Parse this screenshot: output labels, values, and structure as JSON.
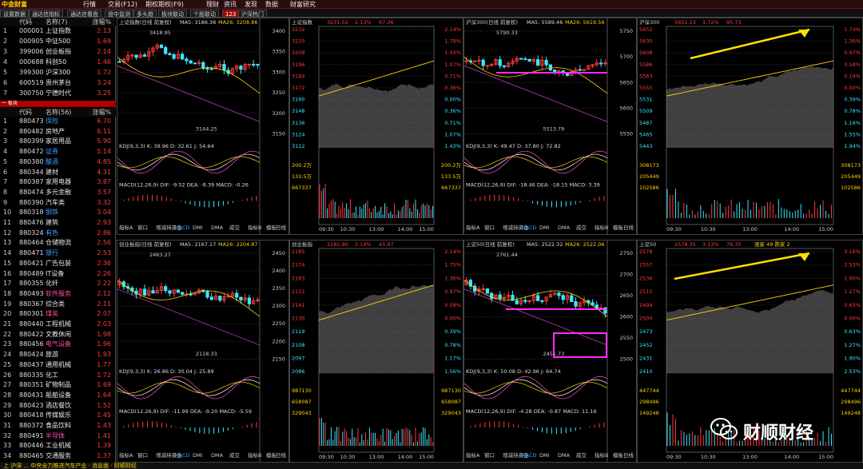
{
  "app": {
    "logo_text": "中金财富",
    "menu": [
      "行情",
      "交易(F12)",
      "期权期权(F9)",
      "理财",
      "资讯",
      "发现",
      "数据",
      "财富研究"
    ]
  },
  "tabs": [
    "设置数据",
    "通达信指标",
    "通达信看盘",
    "盘中监测",
    "多头趋",
    "板块联动",
    "个股联动",
    "123",
    "沪深热门"
  ],
  "left_panel": {
    "header1": {
      "code": "代码",
      "name": "名称(7)",
      "pct": "涨幅%"
    },
    "indices": [
      {
        "idx": "1",
        "code": "000001",
        "name": "上证指数",
        "pct": "2.13"
      },
      {
        "idx": "2",
        "code": "000905",
        "name": "中证500",
        "pct": "1.69"
      },
      {
        "idx": "3",
        "code": "399006",
        "name": "创业板指",
        "pct": "2.14"
      },
      {
        "idx": "4",
        "code": "000688",
        "name": "科创50",
        "pct": "1.46"
      },
      {
        "idx": "5",
        "code": "399300",
        "name": "沪深300",
        "pct": "1.72"
      },
      {
        "idx": "6",
        "code": "600519",
        "name": "贵州茅台",
        "pct": "3.24"
      },
      {
        "idx": "7",
        "code": "300750",
        "name": "宁德时代",
        "pct": "3.25"
      }
    ],
    "divider": "一 板块",
    "header2": {
      "code": "代码",
      "name": "名称(56)",
      "pct": "涨幅%"
    },
    "sectors": [
      {
        "idx": "1",
        "code": "880473",
        "name": "保险",
        "pct": "6.70",
        "color": "blue"
      },
      {
        "idx": "2",
        "code": "880482",
        "name": "房地产",
        "pct": "6.11",
        "color": ""
      },
      {
        "idx": "3",
        "code": "880399",
        "name": "家居用品",
        "pct": "5.90",
        "color": ""
      },
      {
        "idx": "4",
        "code": "880472",
        "name": "证券",
        "pct": "5.14",
        "color": "blue"
      },
      {
        "idx": "5",
        "code": "880380",
        "name": "酿酒",
        "pct": "4.85",
        "color": "blue"
      },
      {
        "idx": "6",
        "code": "880344",
        "name": "建材",
        "pct": "4.31",
        "color": ""
      },
      {
        "idx": "7",
        "code": "880387",
        "name": "家用电器",
        "pct": "3.87",
        "color": ""
      },
      {
        "idx": "8",
        "code": "880474",
        "name": "多元金融",
        "pct": "3.57",
        "color": ""
      },
      {
        "idx": "9",
        "code": "880390",
        "name": "汽车类",
        "pct": "3.32",
        "color": ""
      },
      {
        "idx": "10",
        "code": "880318",
        "name": "钢铁",
        "pct": "3.04",
        "color": "blue"
      },
      {
        "idx": "11",
        "code": "880476",
        "name": "建筑",
        "pct": "2.93",
        "color": ""
      },
      {
        "idx": "12",
        "code": "880324",
        "name": "有色",
        "pct": "2.86",
        "color": "blue"
      },
      {
        "idx": "13",
        "code": "880464",
        "name": "仓储物流",
        "pct": "2.56",
        "color": ""
      },
      {
        "idx": "14",
        "code": "880471",
        "name": "银行",
        "pct": "2.53",
        "color": "blue"
      },
      {
        "idx": "15",
        "code": "880421",
        "name": "广告包装",
        "pct": "2.36",
        "color": ""
      },
      {
        "idx": "16",
        "code": "880489",
        "name": "IT设备",
        "pct": "2.26",
        "color": ""
      },
      {
        "idx": "17",
        "code": "880355",
        "name": "化纤",
        "pct": "2.22",
        "color": ""
      },
      {
        "idx": "18",
        "code": "880493",
        "name": "软件服务",
        "pct": "2.12",
        "color": "pink"
      },
      {
        "idx": "19",
        "code": "880367",
        "name": "综合类",
        "pct": "2.11",
        "color": ""
      },
      {
        "idx": "20",
        "code": "880301",
        "name": "煤炭",
        "pct": "2.07",
        "color": "pink"
      },
      {
        "idx": "21",
        "code": "880440",
        "name": "工程机械",
        "pct": "2.03",
        "color": ""
      },
      {
        "idx": "22",
        "code": "880422",
        "name": "文教休闲",
        "pct": "1.98",
        "color": ""
      },
      {
        "idx": "23",
        "code": "880456",
        "name": "电气设备",
        "pct": "1.96",
        "color": "pink"
      },
      {
        "idx": "24",
        "code": "880424",
        "name": "旅游",
        "pct": "1.93",
        "color": ""
      },
      {
        "idx": "25",
        "code": "880437",
        "name": "通用机械",
        "pct": "1.77",
        "color": ""
      },
      {
        "idx": "26",
        "code": "880335",
        "name": "化工",
        "pct": "1.72",
        "color": ""
      },
      {
        "idx": "27",
        "code": "880351",
        "name": "矿物制品",
        "pct": "1.69",
        "color": ""
      },
      {
        "idx": "28",
        "code": "880431",
        "name": "船舶设备",
        "pct": "1.64",
        "color": ""
      },
      {
        "idx": "29",
        "code": "880423",
        "name": "酒店餐饮",
        "pct": "1.52",
        "color": ""
      },
      {
        "idx": "30",
        "code": "880418",
        "name": "传媒娱乐",
        "pct": "1.45",
        "color": ""
      },
      {
        "idx": "31",
        "code": "880372",
        "name": "食品饮料",
        "pct": "1.43",
        "color": ""
      },
      {
        "idx": "32",
        "code": "880491",
        "name": "半导体",
        "pct": "1.41",
        "color": "pink"
      },
      {
        "idx": "33",
        "code": "880446",
        "name": "工业机械",
        "pct": "1.39",
        "color": ""
      },
      {
        "idx": "34",
        "code": "880465",
        "name": "交通服务",
        "pct": "1.37",
        "color": ""
      }
    ]
  },
  "charts": {
    "tl": {
      "title": "上证指数(日线 前复权)",
      "ma5": "MA5: 3186.36",
      "ma26": "MA26: 3208.86",
      "high": "3418.95",
      "low": "3144.25",
      "kdj": "KDJ(9,3,3) K: 39.96 D: 32.61 J: 54.64",
      "macd": "MACD(12,26,9) DIF: -9.52 DEA: -8.39 MACD: -0.26",
      "axis": [
        "3400",
        "3350",
        "3300",
        "3250",
        "3200",
        "3150"
      ]
    },
    "tl2": {
      "title": "上证指数",
      "price": "3231.52",
      "chg": "2.13%",
      "pts": "67.36",
      "axis": [
        "3232",
        "3220",
        "3208",
        "3196",
        "3184",
        "3172",
        "3160",
        "3148",
        "3136",
        "3124",
        "3112"
      ],
      "pcts": [
        "2.14%",
        "1.78%",
        "1.43%",
        "1.07%",
        "0.71%",
        "0.36%",
        "0.00%",
        "0.36%",
        "0.71%",
        "1.07%",
        "1.43%"
      ],
      "vol": [
        "200.2万",
        "133.5万",
        "667337"
      ]
    },
    "tr": {
      "title": "沪深300(日线 前复权)",
      "ma5": "MA5: 5589.46",
      "ma26": "MA26: 5619.56",
      "high": "5790.33",
      "low": "5513.79",
      "kdj": "KDJ(9,3,3) K: 49.47 D: 37.80 J: 72.82",
      "macd": "MACD(12,26,9) DIF: -18.46 DEA: -18.15 MACD: 3.39",
      "axis": [
        "5750",
        "5700",
        "5650",
        "5600",
        "5550"
      ]
    },
    "tr2": {
      "title": "沪深300",
      "price": "5651.13",
      "chg": "1.72%",
      "pts": "95.73",
      "axis": [
        "5652",
        "5630",
        "5608",
        "5586",
        "5563",
        "5555",
        "5531",
        "5509",
        "5487",
        "5465",
        "5443"
      ],
      "pcts": [
        "1.74%",
        "1.36%",
        "0.97%",
        "0.58%",
        "0.19%",
        "0.00%",
        "0.39%",
        "0.78%",
        "1.16%",
        "1.55%",
        "1.94%"
      ],
      "vol": [
        "308173",
        "205449",
        "102586"
      ]
    },
    "bl": {
      "title": "创业板指(日线 前复权)",
      "ma5": "MA5: 2167.17",
      "ma26": "MA26: 2204.87",
      "high": "2463.27",
      "low": "2118.33",
      "kdj": "KDJ(9,3,3) K: 26.86 D: 30.04 J: 25.89",
      "macd": "MACD(12,26,9) DIF: -11.99 DEA: -9.20 MACD: -5.59",
      "axis": [
        "2450",
        "2400",
        "2350",
        "2300",
        "2250",
        "2200",
        "2150"
      ]
    },
    "bl2": {
      "title": "创业板指",
      "price": "2182.90",
      "chg": "2.14%",
      "pts": "45.97",
      "axis": [
        "2185",
        "2174",
        "2163",
        "2152",
        "2141",
        "2130",
        "2119",
        "2108",
        "2097",
        "2086"
      ],
      "pcts": [
        "2.14%",
        "1.75%",
        "1.36%",
        "0.97%",
        "0.58%",
        "0.00%",
        "0.39%",
        "0.78%",
        "1.17%",
        "1.56%"
      ],
      "vol": [
        "987130",
        "658087",
        "329043"
      ]
    },
    "br": {
      "title": "上证50(日线 前复权)",
      "ma5": "MA5: 2522.32",
      "ma26": "MA26: 2522.06",
      "high": "2761.44",
      "low": "2451.73",
      "kdj": "KDJ(9,3,3) K: 50.08 D: 42.96 J: 64.74",
      "macd": "MACD(12,26,9) DIF: -4.28 DEA: -0.87 MACD: 11.16",
      "axis": [
        "2750",
        "2700",
        "2650",
        "2600",
        "2550",
        "2500"
      ]
    },
    "br2": {
      "title": "上证50",
      "price": "2578.35",
      "chg": "3.13%",
      "pts": "78.35",
      "axis": [
        "2578",
        "2557",
        "2536",
        "2515",
        "2494",
        "2500",
        "2473",
        "2452",
        "2431",
        "2410"
      ],
      "pcts": [
        "3.16%",
        "2.53%",
        "1.90%",
        "1.27%",
        "0.63%",
        "0.00%",
        "0.63%",
        "1.27%",
        "1.90%",
        "2.53%"
      ],
      "vol": [
        "447744",
        "298496",
        "149248"
      ],
      "extra": "涨家 49 跌家 2"
    }
  },
  "chart_toolbar": [
    "指标A",
    "窗口",
    "增减持资金",
    "MACD",
    "DMI",
    "DMA",
    "成交",
    "指标B",
    "模板"
  ],
  "times": [
    "09:30",
    "10:30",
    "13:00",
    "14:00",
    "15:00"
  ],
  "year_label": "2023年",
  "day_label": "日线",
  "bottom_strip": "上  沪深 ... 中央全力推进汽车产业 · 消息面 · 财顺财经",
  "watermark": "财顺财经"
}
